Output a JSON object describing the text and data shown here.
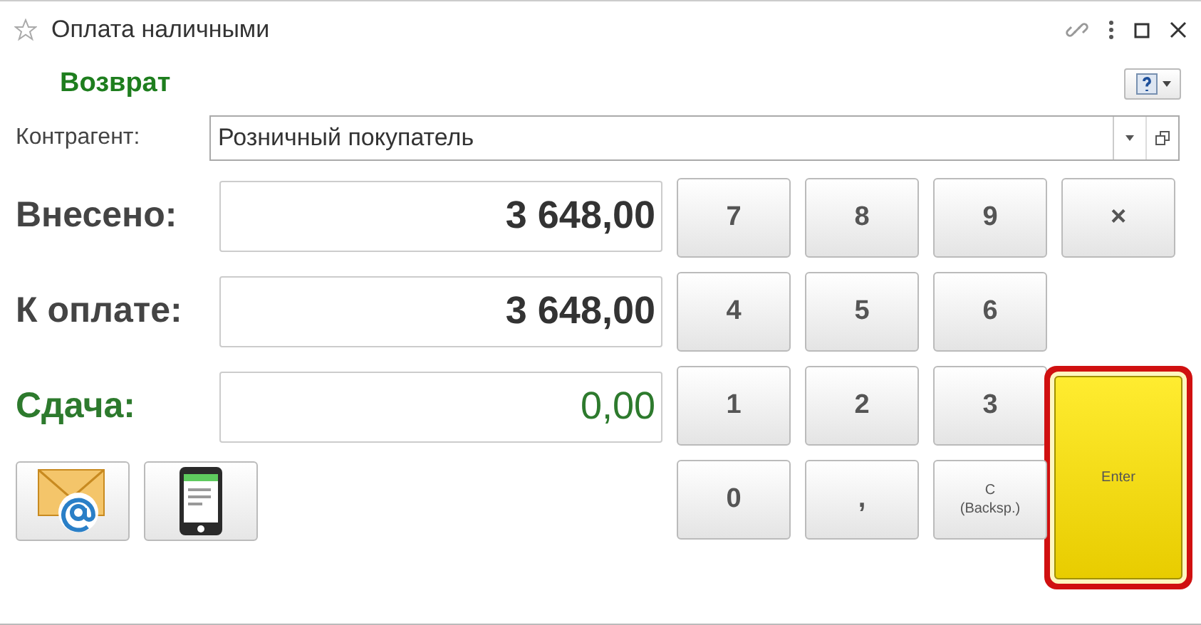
{
  "window": {
    "title": "Оплата наличными"
  },
  "operation": "Возврат",
  "counterparty": {
    "label": "Контрагент:",
    "value": "Розничный покупатель"
  },
  "amounts": [
    {
      "label": "Внесено:",
      "value": "3 648,00",
      "kind": "total"
    },
    {
      "label": "К оплате:",
      "value": "3 648,00",
      "kind": "total"
    },
    {
      "label": "Сдача:",
      "value": "0,00",
      "kind": "change"
    }
  ],
  "keypad": [
    [
      {
        "label": "7",
        "kind": "key"
      },
      {
        "label": "8",
        "kind": "key"
      },
      {
        "label": "9",
        "kind": "key"
      },
      {
        "label": "×",
        "kind": "key"
      }
    ],
    [
      {
        "label": "4",
        "kind": "key"
      },
      {
        "label": "5",
        "kind": "key"
      },
      {
        "label": "6",
        "kind": "key"
      }
    ],
    [
      {
        "label": "1",
        "kind": "key"
      },
      {
        "label": "2",
        "kind": "key"
      },
      {
        "label": "3",
        "kind": "key"
      },
      {
        "label": "Enter",
        "kind": "enter",
        "focused": true
      }
    ],
    [
      {
        "label": "0",
        "kind": "key"
      },
      {
        "label": ",",
        "kind": "key"
      },
      {
        "label": "C\n(Backsp.)",
        "kind": "small"
      }
    ]
  ]
}
